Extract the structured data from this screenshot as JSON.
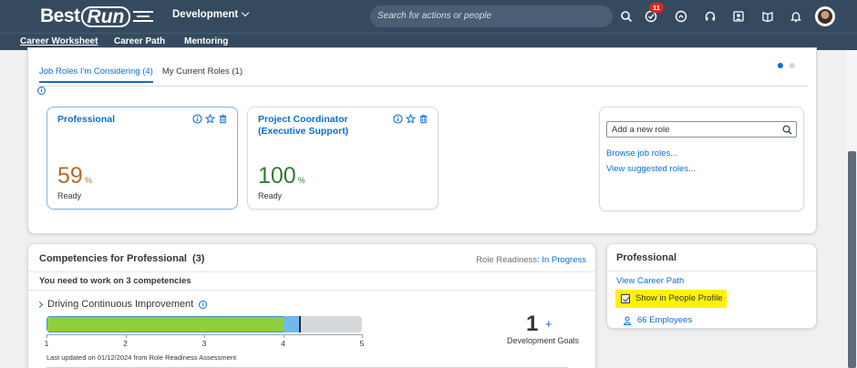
{
  "shell": {
    "logo_best": "Best",
    "logo_run": "Run",
    "product": "Development",
    "search_placeholder": "Search for actions or people",
    "notifications_count": "11"
  },
  "subnav": {
    "items": [
      "Career Worksheet",
      "Career Path",
      "Mentoring"
    ]
  },
  "tabs": {
    "considering": "Job Roles I'm Considering (4)",
    "current": "My Current Roles (1)"
  },
  "roles": [
    {
      "title": "Professional",
      "percent": "59",
      "unit": "%",
      "status": "Ready",
      "color": "#b96a2a"
    },
    {
      "title": "Project Coordinator (Executive Support)",
      "percent": "100",
      "unit": "%",
      "status": "Ready",
      "color": "#2f7d32"
    }
  ],
  "add_role": {
    "placeholder": "Add a new role",
    "browse": "Browse job roles...",
    "suggested": "View suggested roles..."
  },
  "competencies": {
    "title": "Competencies for Professional",
    "count": "(3)",
    "readiness_label": "Role Readiness:",
    "readiness_value": "In Progress",
    "need": "You need to work on 3 competencies",
    "item_name": "Driving Continuous Improvement",
    "current_level": 4,
    "target_level": 4.2,
    "scale_max": 5,
    "ticks": [
      "1",
      "2",
      "3",
      "4",
      "5"
    ],
    "updated": "Last updated on 01/12/2024 from Role Readiness Assessment",
    "goals_count": "1",
    "goals_plus": "+",
    "goals_label": "Development Goals"
  },
  "side": {
    "title": "Professional",
    "view_path": "View Career Path",
    "show_in_profile": "Show in People Profile",
    "employees": "66 Employees"
  }
}
